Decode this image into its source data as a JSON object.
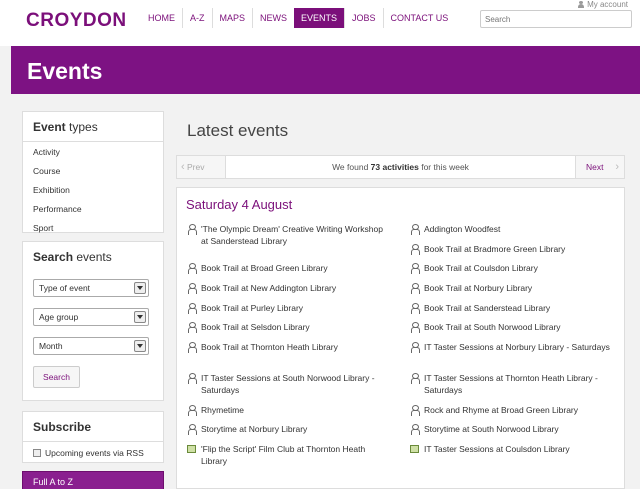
{
  "header": {
    "logo": "CROYDON",
    "my_account": "My account",
    "nav": [
      "HOME",
      "A-Z",
      "MAPS",
      "NEWS",
      "EVENTS",
      "JOBS",
      "CONTACT US"
    ],
    "active_nav": "EVENTS",
    "search_placeholder": "Search"
  },
  "banner": {
    "title": "Events"
  },
  "sidebar": {
    "event_types": {
      "title_bold": "Event",
      "title_rest": " types",
      "items": [
        "Activity",
        "Course",
        "Exhibition",
        "Performance",
        "Sport"
      ]
    },
    "search_events": {
      "title_bold": "Search",
      "title_rest": " events",
      "selects": [
        "Type of event",
        "Age group",
        "Month"
      ],
      "button": "Search"
    },
    "subscribe": {
      "title": "Subscribe",
      "rss_label": "Upcoming events via RSS"
    },
    "full_a_to_z": "Full A to Z"
  },
  "main": {
    "title": "Latest events",
    "pager": {
      "prev": "Prev",
      "next": "Next",
      "found_prefix": "We found ",
      "found_count": "73 activities",
      "found_suffix": " for this week"
    },
    "date_heading": "Saturday 4 August",
    "events": [
      {
        "text": "'The Olympic Dream' Creative Writing Workshop at Sanderstead Library",
        "icon": "person-icon"
      },
      {
        "text": "Addington Woodfest",
        "icon": "person-icon"
      },
      {
        "text": "Book Trail at Bradmore Green Library",
        "icon": "person-icon"
      },
      {
        "text": "Book Trail at Broad Green Library",
        "icon": "person-icon"
      },
      {
        "text": "Book Trail at Coulsdon Library",
        "icon": "person-icon"
      },
      {
        "text": "Book Trail at New Addington Library",
        "icon": "person-icon"
      },
      {
        "text": "Book Trail at Norbury Library",
        "icon": "person-icon"
      },
      {
        "text": "Book Trail at Purley Library",
        "icon": "person-icon"
      },
      {
        "text": "Book Trail at Sanderstead Library",
        "icon": "person-icon"
      },
      {
        "text": "Book Trail at Selsdon Library",
        "icon": "person-icon"
      },
      {
        "text": "Book Trail at South Norwood Library",
        "icon": "person-icon"
      },
      {
        "text": "Book Trail at Thornton Heath Library",
        "icon": "person-icon"
      },
      {
        "text": "IT Taster Sessions at Norbury Library - Saturdays",
        "icon": "person-icon"
      },
      {
        "text": "IT Taster Sessions at South Norwood Library - Saturdays",
        "icon": "person-icon"
      },
      {
        "text": "IT Taster Sessions at Thornton Heath Library - Saturdays",
        "icon": "person-icon"
      },
      {
        "text": "Rhymetime",
        "icon": "person-icon"
      },
      {
        "text": "Rock and Rhyme at Broad Green Library",
        "icon": "person-icon"
      },
      {
        "text": "Storytime at Norbury Library",
        "icon": "person-icon"
      },
      {
        "text": "Storytime at South Norwood Library",
        "icon": "person-icon"
      },
      {
        "text": "'Flip the Script' Film Club at Thornton Heath Library",
        "icon": "film-icon"
      },
      {
        "text": "IT Taster Sessions at Coulsdon Library",
        "icon": "film-icon"
      }
    ]
  }
}
